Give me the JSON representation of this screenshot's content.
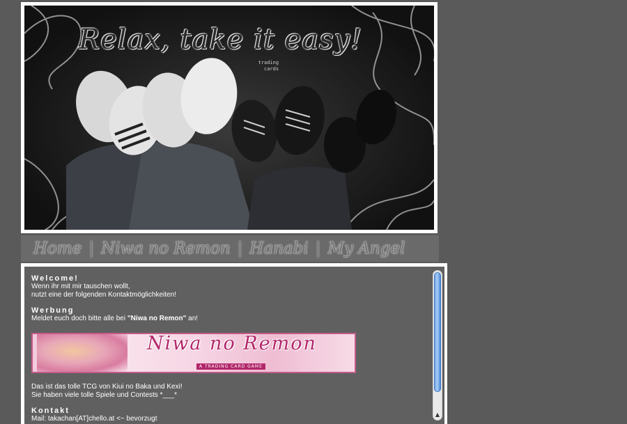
{
  "header": {
    "title": "Relax, take it easy!",
    "subtitle_line1": "trading",
    "subtitle_line2": "cards"
  },
  "nav": {
    "items": [
      {
        "label": "Home"
      },
      {
        "label": "Niwa no Remon"
      },
      {
        "label": "Hanabi"
      },
      {
        "label": "My Angel"
      }
    ],
    "separator": "|"
  },
  "content": {
    "welcome_title": "Welcome!",
    "welcome_line1": "Wenn ihr mit mir tauschen wollt,",
    "welcome_line2": "nutzt eine der folgenden Kontaktmöglichkeiten!",
    "werbung_title": "Werbung",
    "werbung_text_pre": "Meldet euch doch bitte alle bei ",
    "werbung_link": "\"Niwa no Remon\"",
    "werbung_text_post": " an!",
    "banner_logo": "Niwa no Remon",
    "banner_tag": "A TRADING CARD GAME",
    "tcg_line1": "Das ist das tolle TCG von Kiui no Baka und Kexi!",
    "tcg_line2": "Sie haben viele tolle Spiele und Contests *___*",
    "kontakt_title": "Kontakt",
    "kontakt_mail": "Mail: takachan[AT]chello.at <~ bevorzugt"
  },
  "scrollbar": {
    "arrow": "▲"
  }
}
